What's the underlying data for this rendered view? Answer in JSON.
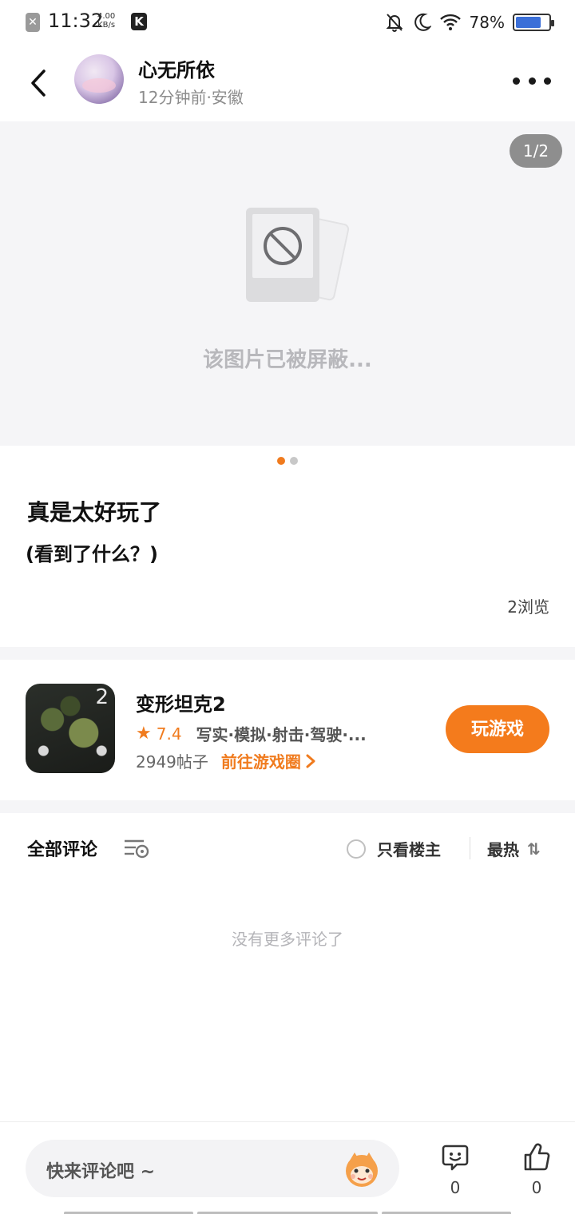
{
  "status_bar": {
    "time": "11:32",
    "net_speed_value": "4.00",
    "net_speed_unit": "KB/s",
    "battery_percent": "78%",
    "battery_level": 0.78,
    "icons": [
      "close-notification-icon",
      "k-app-icon",
      "bell-off-icon",
      "moon-icon",
      "wifi-icon",
      "battery-icon"
    ]
  },
  "header": {
    "username": "心无所依",
    "meta": "12分钟前·安徽"
  },
  "image_viewer": {
    "pager": "1/2",
    "blocked_text": "该图片已被屏蔽...",
    "total_pages": 2,
    "current_page": 1
  },
  "post": {
    "title": "真是太好玩了",
    "body": "(看到了什么？)",
    "views": "2浏览"
  },
  "game": {
    "icon_number": "2",
    "name": "变形坦克2",
    "rating": "7.4",
    "tags": "写实·模拟·射击·驾驶·...",
    "posts": "2949帖子",
    "goto_label": "前往游戏圈",
    "play_label": "玩游戏"
  },
  "comments": {
    "title": "全部评论",
    "only_op_label": "只看楼主",
    "sort_label": "最热",
    "sort_icon": "⇅",
    "empty_text": "没有更多评论了"
  },
  "bottom_bar": {
    "placeholder": "快来评论吧 ~",
    "comment_count": "0",
    "like_count": "0"
  },
  "colors": {
    "accent": "#f47b1c",
    "battery": "#3b6fd8",
    "placeholder_bg": "#f5f5f7"
  }
}
